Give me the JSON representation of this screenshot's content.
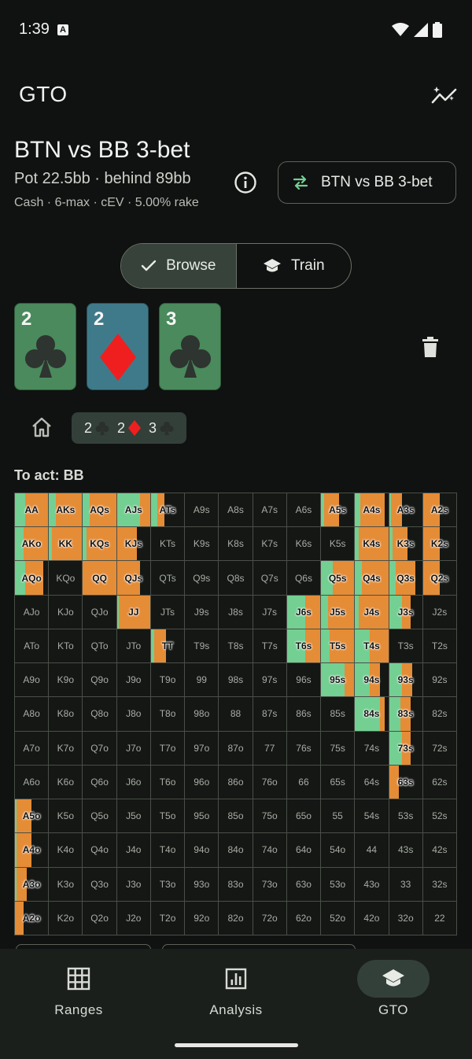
{
  "status": {
    "time": "1:39"
  },
  "header": {
    "title": "GTO"
  },
  "spot": {
    "title": "BTN vs BB 3-bet",
    "pot": "Pot 22.5bb · behind 89bb",
    "meta": "Cash · 6-max · cEV · 5.00% rake",
    "button_label": "BTN vs BB 3-bet"
  },
  "mode": {
    "browse": "Browse",
    "train": "Train",
    "selected": "Browse"
  },
  "board": [
    {
      "rank": "2",
      "suit": "clubs",
      "color": "#4a8a5c"
    },
    {
      "rank": "2",
      "suit": "diamonds",
      "color": "#3f7a8a"
    },
    {
      "rank": "3",
      "suit": "clubs",
      "color": "#4a8a5c"
    }
  ],
  "breadcrumb": {
    "r1": "2",
    "r2": "2",
    "r3": "3"
  },
  "to_act": "To act: BB",
  "colors": {
    "green": "#74cf92",
    "orange": "#e58c37"
  },
  "grid": [
    [
      "AA",
      "AKs",
      "AQs",
      "AJs",
      "ATs",
      "A9s",
      "A8s",
      "A7s",
      "A6s",
      "A5s",
      "A4s",
      "A3s",
      "A2s"
    ],
    [
      "AKo",
      "KK",
      "KQs",
      "KJs",
      "KTs",
      "K9s",
      "K8s",
      "K7s",
      "K6s",
      "K5s",
      "K4s",
      "K3s",
      "K2s"
    ],
    [
      "AQo",
      "KQo",
      "QQ",
      "QJs",
      "QTs",
      "Q9s",
      "Q8s",
      "Q7s",
      "Q6s",
      "Q5s",
      "Q4s",
      "Q3s",
      "Q2s"
    ],
    [
      "AJo",
      "KJo",
      "QJo",
      "JJ",
      "JTs",
      "J9s",
      "J8s",
      "J7s",
      "J6s",
      "J5s",
      "J4s",
      "J3s",
      "J2s"
    ],
    [
      "ATo",
      "KTo",
      "QTo",
      "JTo",
      "TT",
      "T9s",
      "T8s",
      "T7s",
      "T6s",
      "T5s",
      "T4s",
      "T3s",
      "T2s"
    ],
    [
      "A9o",
      "K9o",
      "Q9o",
      "J9o",
      "T9o",
      "99",
      "98s",
      "97s",
      "96s",
      "95s",
      "94s",
      "93s",
      "92s"
    ],
    [
      "A8o",
      "K8o",
      "Q8o",
      "J8o",
      "T8o",
      "98o",
      "88",
      "87s",
      "86s",
      "85s",
      "84s",
      "83s",
      "82s"
    ],
    [
      "A7o",
      "K7o",
      "Q7o",
      "J7o",
      "T7o",
      "97o",
      "87o",
      "77",
      "76s",
      "75s",
      "74s",
      "73s",
      "72s"
    ],
    [
      "A6o",
      "K6o",
      "Q6o",
      "J6o",
      "T6o",
      "96o",
      "86o",
      "76o",
      "66",
      "65s",
      "64s",
      "63s",
      "62s"
    ],
    [
      "A5o",
      "K5o",
      "Q5o",
      "J5o",
      "T5o",
      "95o",
      "85o",
      "75o",
      "65o",
      "55",
      "54s",
      "53s",
      "52s"
    ],
    [
      "A4o",
      "K4o",
      "Q4o",
      "J4o",
      "T4o",
      "94o",
      "84o",
      "74o",
      "64o",
      "54o",
      "44",
      "43s",
      "42s"
    ],
    [
      "A3o",
      "K3o",
      "Q3o",
      "J3o",
      "T3o",
      "93o",
      "83o",
      "73o",
      "63o",
      "53o",
      "43o",
      "33",
      "32s"
    ],
    [
      "A2o",
      "K2o",
      "Q2o",
      "J2o",
      "T2o",
      "92o",
      "82o",
      "72o",
      "62o",
      "52o",
      "42o",
      "32o",
      "22"
    ]
  ],
  "frequencies": {
    "AA": {
      "green": 0.3,
      "orange": 0.7
    },
    "AKs": {
      "green": 0.2,
      "orange": 0.8
    },
    "AQs": {
      "green": 0.2,
      "orange": 0.8
    },
    "AJs": {
      "green": 0.7,
      "orange": 0.3
    },
    "ATs": {
      "green": 0.2,
      "orange": 0.2
    },
    "A5s": {
      "green": 0.1,
      "orange": 0.45
    },
    "A4s": {
      "green": 0.15,
      "orange": 0.75
    },
    "A3s": {
      "green": 0.05,
      "orange": 0.35
    },
    "A2s": {
      "green": 0.0,
      "orange": 0.5
    },
    "AKo": {
      "green": 0.25,
      "orange": 0.75
    },
    "KK": {
      "green": 0.1,
      "orange": 0.9
    },
    "KQs": {
      "green": 0.1,
      "orange": 0.9
    },
    "KJs": {
      "green": 0.0,
      "orange": 0.6
    },
    "K4s": {
      "green": 0.1,
      "orange": 0.9
    },
    "K3s": {
      "green": 0.1,
      "orange": 0.45
    },
    "K2s": {
      "green": 0.0,
      "orange": 0.5
    },
    "AQo": {
      "green": 0.3,
      "orange": 0.55
    },
    "QQ": {
      "green": 0.0,
      "orange": 1.0
    },
    "QJs": {
      "green": 0.0,
      "orange": 0.7
    },
    "Q5s": {
      "green": 0.35,
      "orange": 0.65
    },
    "Q4s": {
      "green": 0.2,
      "orange": 0.8
    },
    "Q3s": {
      "green": 0.2,
      "orange": 0.6
    },
    "Q2s": {
      "green": 0.0,
      "orange": 0.5
    },
    "JJ": {
      "green": 0.05,
      "orange": 0.95
    },
    "J6s": {
      "green": 0.55,
      "orange": 0.45
    },
    "J5s": {
      "green": 0.2,
      "orange": 0.8
    },
    "J4s": {
      "green": 0.1,
      "orange": 0.9
    },
    "J3s": {
      "green": 0.4,
      "orange": 0.25
    },
    "TT": {
      "green": 0.1,
      "orange": 0.35
    },
    "T6s": {
      "green": 0.55,
      "orange": 0.45
    },
    "T5s": {
      "green": 0.25,
      "orange": 0.75
    },
    "T4s": {
      "green": 0.45,
      "orange": 0.55
    },
    "95s": {
      "green": 0.7,
      "orange": 0.3
    },
    "94s": {
      "green": 0.45,
      "orange": 0.3
    },
    "93s": {
      "green": 0.4,
      "orange": 0.3
    },
    "84s": {
      "green": 0.75,
      "orange": 0.15
    },
    "83s": {
      "green": 0.35,
      "orange": 0.3
    },
    "73s": {
      "green": 0.4,
      "orange": 0.25
    },
    "63s": {
      "green": 0.0,
      "orange": 0.3
    },
    "A5o": {
      "green": 0.05,
      "orange": 0.45
    },
    "A4o": {
      "green": 0.05,
      "orange": 0.45
    },
    "A3o": {
      "green": 0.05,
      "orange": 0.3
    },
    "A2o": {
      "green": 0.0,
      "orange": 0.25
    }
  },
  "nav": {
    "ranges": "Ranges",
    "analysis": "Analysis",
    "gto": "GTO",
    "active": "GTO"
  }
}
